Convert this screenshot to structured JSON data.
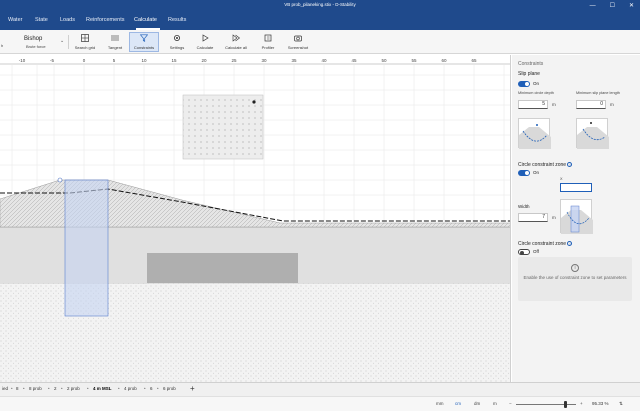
{
  "window": {
    "title": "VB prob_pilaneking.stix - D-Stability",
    "minimize": "—",
    "maximize": "☐",
    "close": "✕"
  },
  "menu": {
    "items": [
      "Water",
      "State",
      "Loads",
      "Reinforcements",
      "Calculate",
      "Results"
    ],
    "active": "Calculate"
  },
  "ribbon": {
    "partial_label": "h",
    "method": "Bishop",
    "method_sub": "Brute force",
    "dropdown": "⌄",
    "buttons": [
      "Search grid",
      "Tangent",
      "Constraints",
      "Settings",
      "Calculate",
      "Calculate all",
      "Profiler",
      "Screenshot"
    ],
    "active": "Constraints"
  },
  "canvas": {
    "x_ticks": [
      "-10",
      "-5",
      "0",
      "5",
      "10",
      "15",
      "20",
      "25",
      "30",
      "35",
      "40",
      "45",
      "50",
      "55",
      "60",
      "65"
    ]
  },
  "panel": {
    "header": "Constraints",
    "slip_plane": {
      "title": "Slip plane",
      "toggle": "On",
      "enabled": true,
      "min_depth_label": "Minimum circle depth",
      "min_depth_value": "5",
      "min_depth_unit": "m",
      "min_length_label": "Minimum slip plane length",
      "min_length_value": "0",
      "min_length_unit": "m"
    },
    "zone1": {
      "title": "Circle constraint zone",
      "toggle": "On",
      "enabled": true,
      "x_label": "X",
      "x_value": "",
      "width_label": "Width",
      "width_value": "7",
      "width_unit": "m"
    },
    "zone2": {
      "title": "Circle constraint zone",
      "toggle": "Off",
      "enabled": false,
      "info_text": "Enable the use of constraint zone to set parameters"
    }
  },
  "tabs": {
    "items": [
      "ied",
      "8",
      "8 prob",
      "2",
      "2 prob",
      "4 m MSL",
      "4 prob",
      "6",
      "6 prob"
    ],
    "active": "4 m MSL",
    "bullet": "•",
    "add": "+"
  },
  "statusbar": {
    "units": [
      "mm",
      "cm",
      "dm",
      "m"
    ],
    "active_unit": "cm",
    "zoom": "95.33 %",
    "zoom_fraction": 0.82,
    "zoom_minus": "−",
    "zoom_plus": "+",
    "icon_text": "⇅"
  },
  "colors": {
    "accent": "#1f4a8c",
    "selection": "#1f5fb8",
    "zone_fill": "#c5d3f2"
  }
}
